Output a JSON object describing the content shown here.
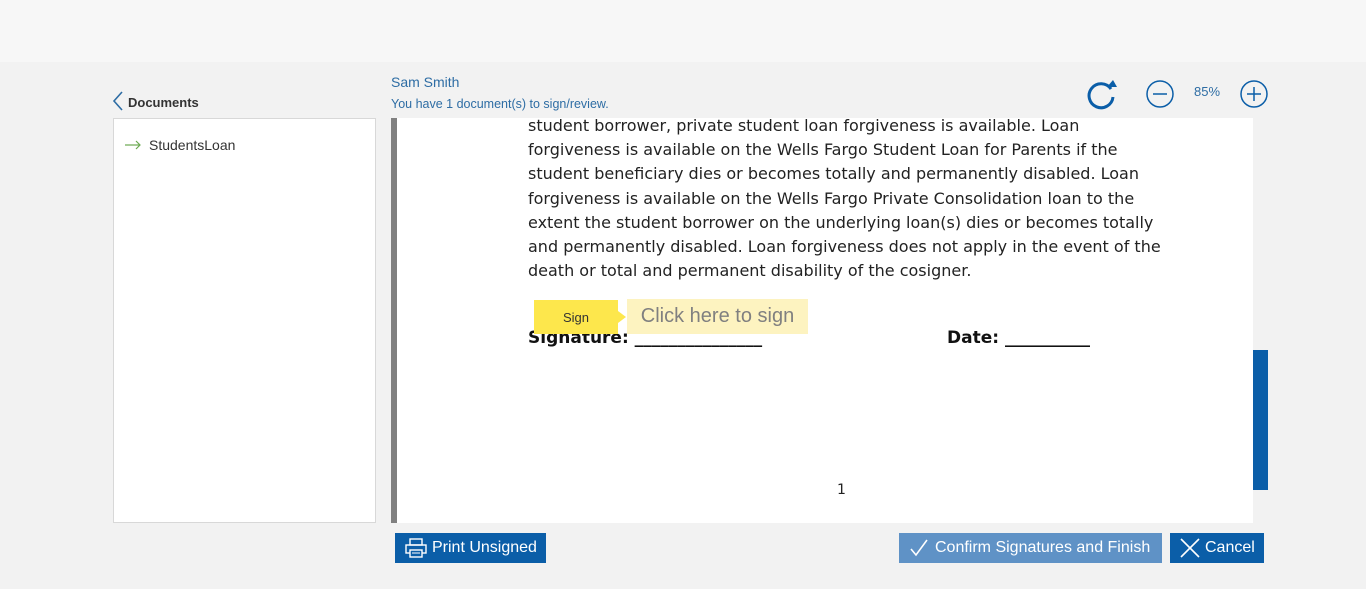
{
  "sidebar": {
    "back_label": "Documents",
    "documents": [
      {
        "name": "StudentsLoan"
      }
    ]
  },
  "header": {
    "user_name": "Sam Smith",
    "status": "You have 1 document(s) to sign/review."
  },
  "toolbar": {
    "zoom_level": "85%"
  },
  "document": {
    "lines": [
      "student borrower, private student loan forgiveness is available. Loan",
      "forgiveness is available on the Wells Fargo Student Loan for Parents if the",
      "student beneficiary dies or becomes totally and permanently disabled. Loan",
      "forgiveness is available on the Wells Fargo Private Consolidation loan to the",
      "extent the student borrower on the underlying loan(s) dies or becomes totally",
      "and permanently disabled. Loan forgiveness does not apply in the event of the",
      "death or total and permanent disability of the cosigner."
    ],
    "signature_label": "Signature: _______________",
    "date_label": "Date: __________",
    "sign_tag": "Sign",
    "sign_prompt": "Click here to sign",
    "page_number": "1"
  },
  "actions": {
    "print_label": "Print Unsigned",
    "confirm_label": "Confirm Signatures and Finish",
    "cancel_label": "Cancel"
  },
  "colors": {
    "primary": "#0b5ea8",
    "confirm_disabled": "#5f92c6",
    "sign_tag": "#fde74c",
    "sign_box": "#fdf3c0",
    "link_text": "#2e6da4"
  }
}
